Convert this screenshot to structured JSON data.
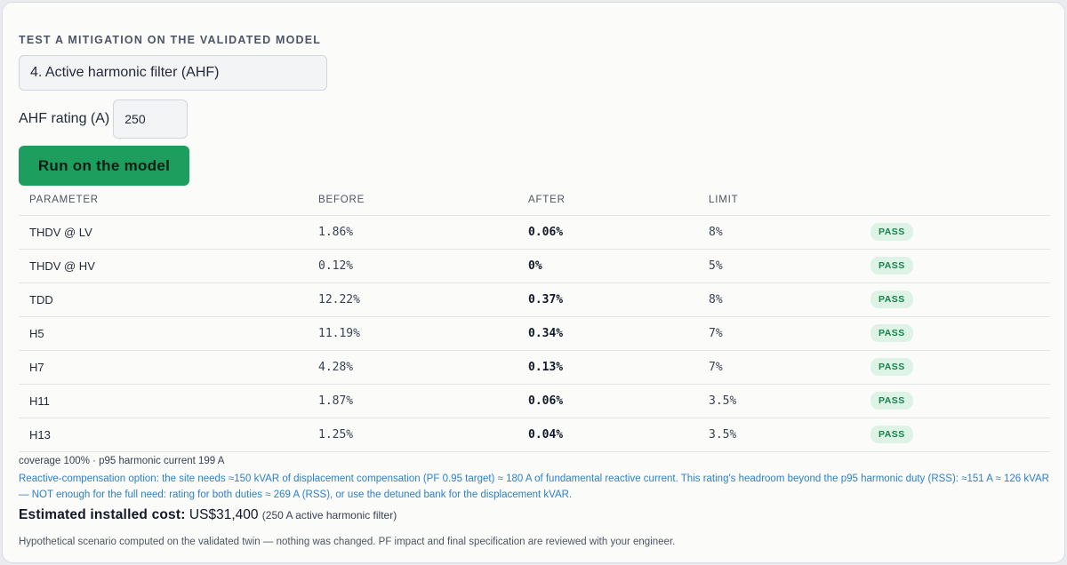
{
  "section_title": "TEST A MITIGATION ON THE VALIDATED MODEL",
  "mitigation_select": {
    "value": "4. Active harmonic filter (AHF)"
  },
  "rating": {
    "label": "AHF rating (A)",
    "value": "250"
  },
  "run_button": {
    "label": "Run on the model"
  },
  "table": {
    "headers": [
      "PARAMETER",
      "BEFORE",
      "AFTER",
      "LIMIT",
      ""
    ],
    "rows": [
      {
        "param": "THDV @ LV",
        "before": "1.86%",
        "after": "0.06%",
        "limit": "8%",
        "status": "PASS"
      },
      {
        "param": "THDV @ HV",
        "before": "0.12%",
        "after": "0%",
        "limit": "5%",
        "status": "PASS"
      },
      {
        "param": "TDD",
        "before": "12.22%",
        "after": "0.37%",
        "limit": "8%",
        "status": "PASS"
      },
      {
        "param": "H5",
        "before": "11.19%",
        "after": "0.34%",
        "limit": "7%",
        "status": "PASS"
      },
      {
        "param": "H7",
        "before": "4.28%",
        "after": "0.13%",
        "limit": "7%",
        "status": "PASS"
      },
      {
        "param": "H11",
        "before": "1.87%",
        "after": "0.06%",
        "limit": "3.5%",
        "status": "PASS"
      },
      {
        "param": "H13",
        "before": "1.25%",
        "after": "0.04%",
        "limit": "3.5%",
        "status": "PASS"
      }
    ]
  },
  "coverage_text": "coverage 100% · p95 harmonic current 199 A",
  "reactive_text": "Reactive-compensation option: the site needs ≈150 kVAR of displacement compensation (PF 0.95 target) ≈ 180 A of fundamental reactive current. This rating's headroom beyond the p95 harmonic duty (RSS): ≈151 A ≈ 126 kVAR — NOT enough for the full need: rating for both duties ≈ 269 A (RSS), or use the detuned bank for the displacement kVAR.",
  "cost": {
    "label": "Estimated installed cost:",
    "value": "US$31,400",
    "note": "(250 A active harmonic filter)"
  },
  "footnote": "Hypothetical scenario computed on the validated twin — nothing was changed. PF impact and final specification are reviewed with your engineer.",
  "colors": {
    "accent_green": "#1e9e5e",
    "pass_bg": "#ddf3e6",
    "pass_text": "#16834b",
    "info_blue": "#2d7fc7"
  }
}
